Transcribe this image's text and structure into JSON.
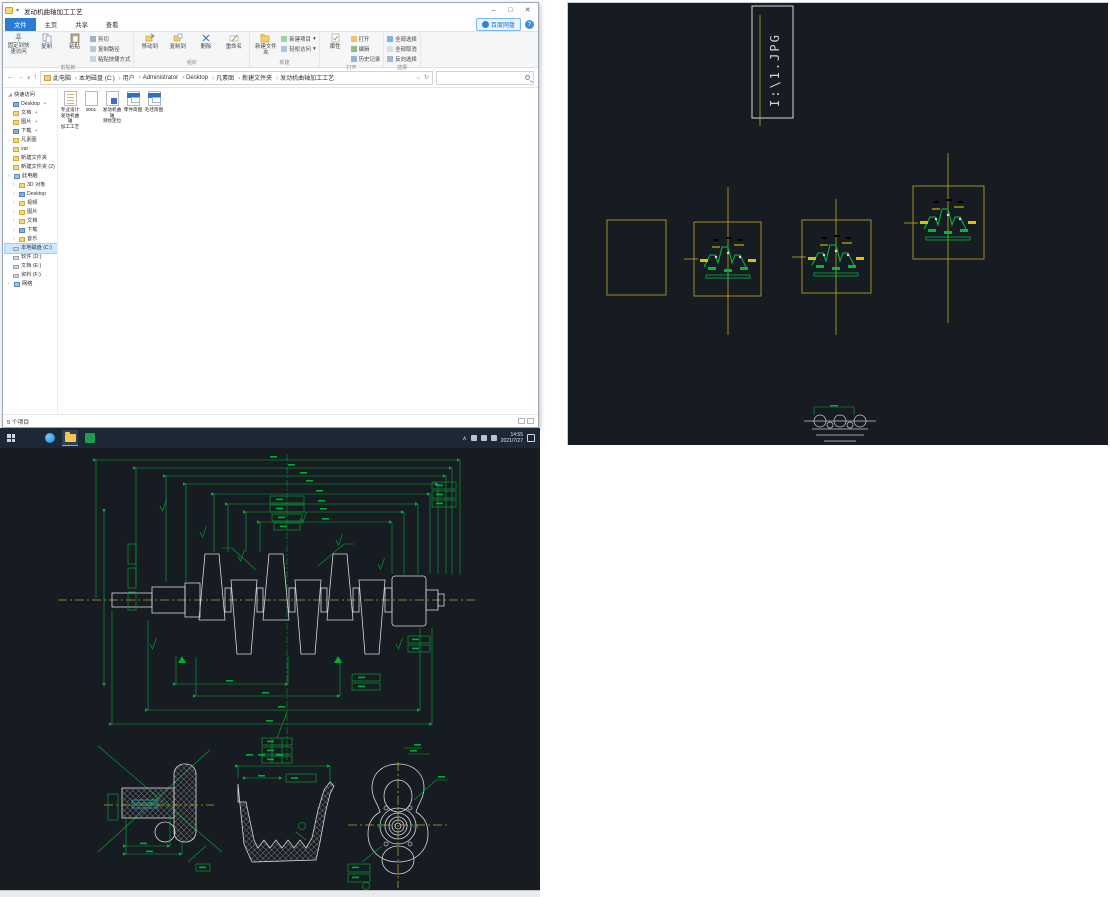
{
  "colors": {
    "cad_bg": "#171c23",
    "cad_green": "#00ad33",
    "cad_yellow": "#c0ac22",
    "cad_white": "#d8d8d8",
    "accent_blue": "#2b7cd3",
    "taskbar_bg": "#1c2836"
  },
  "explorer": {
    "title": "发动机曲轴加工工艺",
    "window_controls": {
      "minimize": "–",
      "maximize": "□",
      "close": "✕"
    },
    "tabs": {
      "file": "文件",
      "home": "主页",
      "share": "共享",
      "view": "查看"
    },
    "netdisk_button": "百度网盘",
    "help": "?",
    "ribbon": {
      "clipboard": {
        "label": "剪贴板",
        "pin": "固定到快速访问",
        "copy": "复制",
        "paste": "粘贴",
        "cut": "剪切",
        "copy_path": "复制路径",
        "paste_shortcut": "粘贴快捷方式"
      },
      "organize": {
        "label": "组织",
        "move_to": "移动到",
        "copy_to": "复制到",
        "delete": "删除",
        "rename": "重命名"
      },
      "new": {
        "label": "新建",
        "new_folder": "新建文件夹",
        "new_item": "新建项目",
        "easy_access": "轻松访问"
      },
      "open": {
        "label": "打开",
        "properties": "属性",
        "open": "打开",
        "edit": "编辑",
        "history": "历史记录"
      },
      "select": {
        "label": "选择",
        "select_all": "全部选择",
        "select_none": "全部取消",
        "invert": "反向选择"
      }
    },
    "address": {
      "crumbs": [
        "此电脑",
        "本地磁盘 (C:)",
        "用户",
        "Administrator",
        "Desktop",
        "凡素图",
        "新建文件夹",
        "发动机曲轴加工工艺"
      ]
    },
    "sidebar": {
      "quick_access": {
        "label": "快速访问",
        "items": [
          "Desktop",
          "文档",
          "图片",
          "下载",
          "凡素图",
          "var",
          "新建文件夹",
          "新建文件夹 (2)"
        ]
      },
      "this_pc": {
        "label": "此电脑",
        "items": [
          "3D 对象",
          "Desktop",
          "视频",
          "图片",
          "文档",
          "下载",
          "音乐",
          "本地磁盘 (C:)",
          "软件 (D:)",
          "文档 (E:)",
          "资料 (F:)"
        ]
      },
      "network": {
        "label": "网络"
      }
    },
    "files": [
      {
        "l1": "专业设计",
        "l2": "发动机曲轴",
        "l3": "加工工艺"
      },
      {
        "l1": "0001",
        "l2": "",
        "l3": ""
      },
      {
        "l1": "发动机曲轴",
        "l2": "测绘定位",
        "l3": ""
      },
      {
        "l1": "零件简图",
        "l2": "",
        "l3": ""
      },
      {
        "l1": "毛坯简图",
        "l2": "",
        "l3": ""
      }
    ],
    "status": "5 个项目"
  },
  "taskbar": {
    "time": "14:55",
    "date": "2021/7/27"
  },
  "cad": {
    "image_label": "I:\\1.JPG"
  }
}
